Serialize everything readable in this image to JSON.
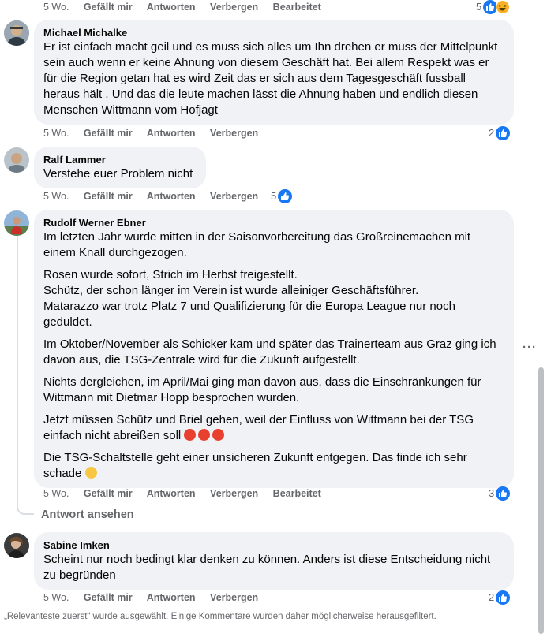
{
  "top_actions": {
    "time": "5 Wo.",
    "like": "Gefällt mir",
    "reply": "Antworten",
    "hide": "Verbergen",
    "edited": "Bearbeitet",
    "reactions": "5"
  },
  "comments": [
    {
      "author": "Michael Michalke",
      "paragraphs": [
        "Er ist einfach macht geil und es muss sich alles um Ihn drehen er muss der Mittelpunkt sein auch wenn er keine Ahnung von diesem Geschäft hat. Bei allem Respekt was er für die Region getan hat es wird Zeit das er sich aus dem Tagesgeschäft fussball heraus hält . Und das die leute machen lässt die Ahnung haben und endlich diesen Menschen Wittmann vom Hofjagt"
      ],
      "time": "5 Wo.",
      "like": "Gefällt mir",
      "reply": "Antworten",
      "hide": "Verbergen",
      "reactions": "2"
    },
    {
      "author": "Ralf Lammer",
      "paragraphs": [
        "Verstehe euer Problem nicht"
      ],
      "time": "5 Wo.",
      "like": "Gefällt mir",
      "reply": "Antworten",
      "hide": "Verbergen",
      "reactions": "5"
    },
    {
      "author": "Rudolf Werner Ebner",
      "paragraphs": [
        "Im letzten Jahr wurde mitten in der Saisonvorbereitung das Großreinemachen mit einem Knall durchgezogen.",
        "Rosen wurde sofort, Strich im Herbst freigestellt.\nSchütz, der schon länger im Verein ist wurde alleiniger Geschäftsführer.\nMatarazzo war trotz Platz 7 und Qualifizierung für die Europa League nur noch geduldet.",
        "Im Oktober/November als Schicker kam und später das Trainerteam aus Graz ging ich davon aus, die TSG-Zentrale wird für die Zukunft aufgestellt.",
        "Nichts dergleichen, im April/Mai ging man davon aus, dass die Einschränkungen für Wittmann mit Dietmar Hopp besprochen wurden.",
        "Jetzt müssen Schütz und Briel gehen, weil der Einfluss von Wittmann bei der TSG einfach nicht abreißen soll",
        "Die TSG-Schaltstelle geht einer unsicheren Zukunft entgegen. Das finde ich sehr schade"
      ],
      "time": "5 Wo.",
      "like": "Gefällt mir",
      "reply": "Antworten",
      "hide": "Verbergen",
      "edited": "Bearbeitet",
      "reactions": "3",
      "view_replies": "Antwort ansehen"
    },
    {
      "author": "Sabine Imken",
      "paragraphs": [
        "Scheint nur noch bedingt klar denken zu können. Anders ist diese Entscheidung nicht zu begründen"
      ],
      "time": "5 Wo.",
      "like": "Gefällt mir",
      "reply": "Antworten",
      "hide": "Verbergen",
      "reactions": "2"
    }
  ],
  "icons": {
    "like": "like-icon",
    "haha": "haha-icon",
    "angry": "angry-emoji",
    "sad": "sad-emoji",
    "more": "more-options-icon"
  },
  "colors": {
    "bubble": "#f0f2f5",
    "like_blue": "#1877f2",
    "meta_gray": "#65676b"
  },
  "footer": "„Relevanteste zuerst“ wurde ausgewählt. Einige Kommentare wurden daher möglicherweise herausgefiltert."
}
